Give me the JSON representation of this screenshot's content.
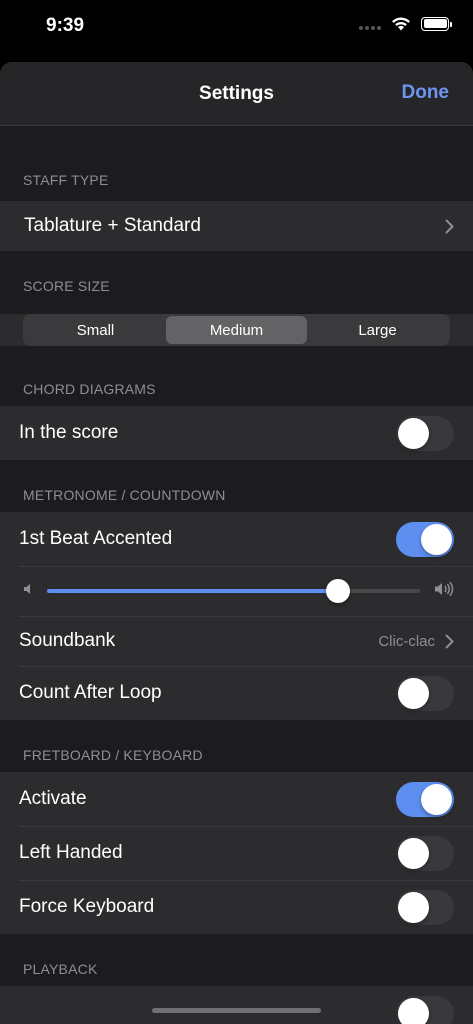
{
  "status_bar": {
    "time": "9:39"
  },
  "nav": {
    "title": "Settings",
    "done_label": "Done"
  },
  "sections": {
    "staff_type": {
      "header": "STAFF TYPE",
      "value_label": "Tablature + Standard"
    },
    "score_size": {
      "header": "SCORE SIZE",
      "options": [
        "Small",
        "Medium",
        "Large"
      ],
      "selected": "Medium"
    },
    "chord_diagrams": {
      "header": "CHORD DIAGRAMS",
      "in_score_label": "In the score",
      "in_score_on": false
    },
    "metronome": {
      "header": "METRONOME / COUNTDOWN",
      "first_beat_label": "1st Beat Accented",
      "first_beat_on": true,
      "volume_level": 0.78,
      "soundbank_label": "Soundbank",
      "soundbank_value": "Clic-clac",
      "count_after_loop_label": "Count After Loop",
      "count_after_loop_on": false
    },
    "fretboard": {
      "header": "FRETBOARD / KEYBOARD",
      "activate_label": "Activate",
      "activate_on": true,
      "left_handed_label": "Left Handed",
      "left_handed_on": false,
      "force_keyboard_label": "Force Keyboard",
      "force_keyboard_on": false
    },
    "playback": {
      "header": "PLAYBACK"
    }
  },
  "colors": {
    "accent": "#6c96f0",
    "toggle_on": "#5e8ff0",
    "background": "#1c1c1e",
    "cell": "#2c2c2e"
  }
}
